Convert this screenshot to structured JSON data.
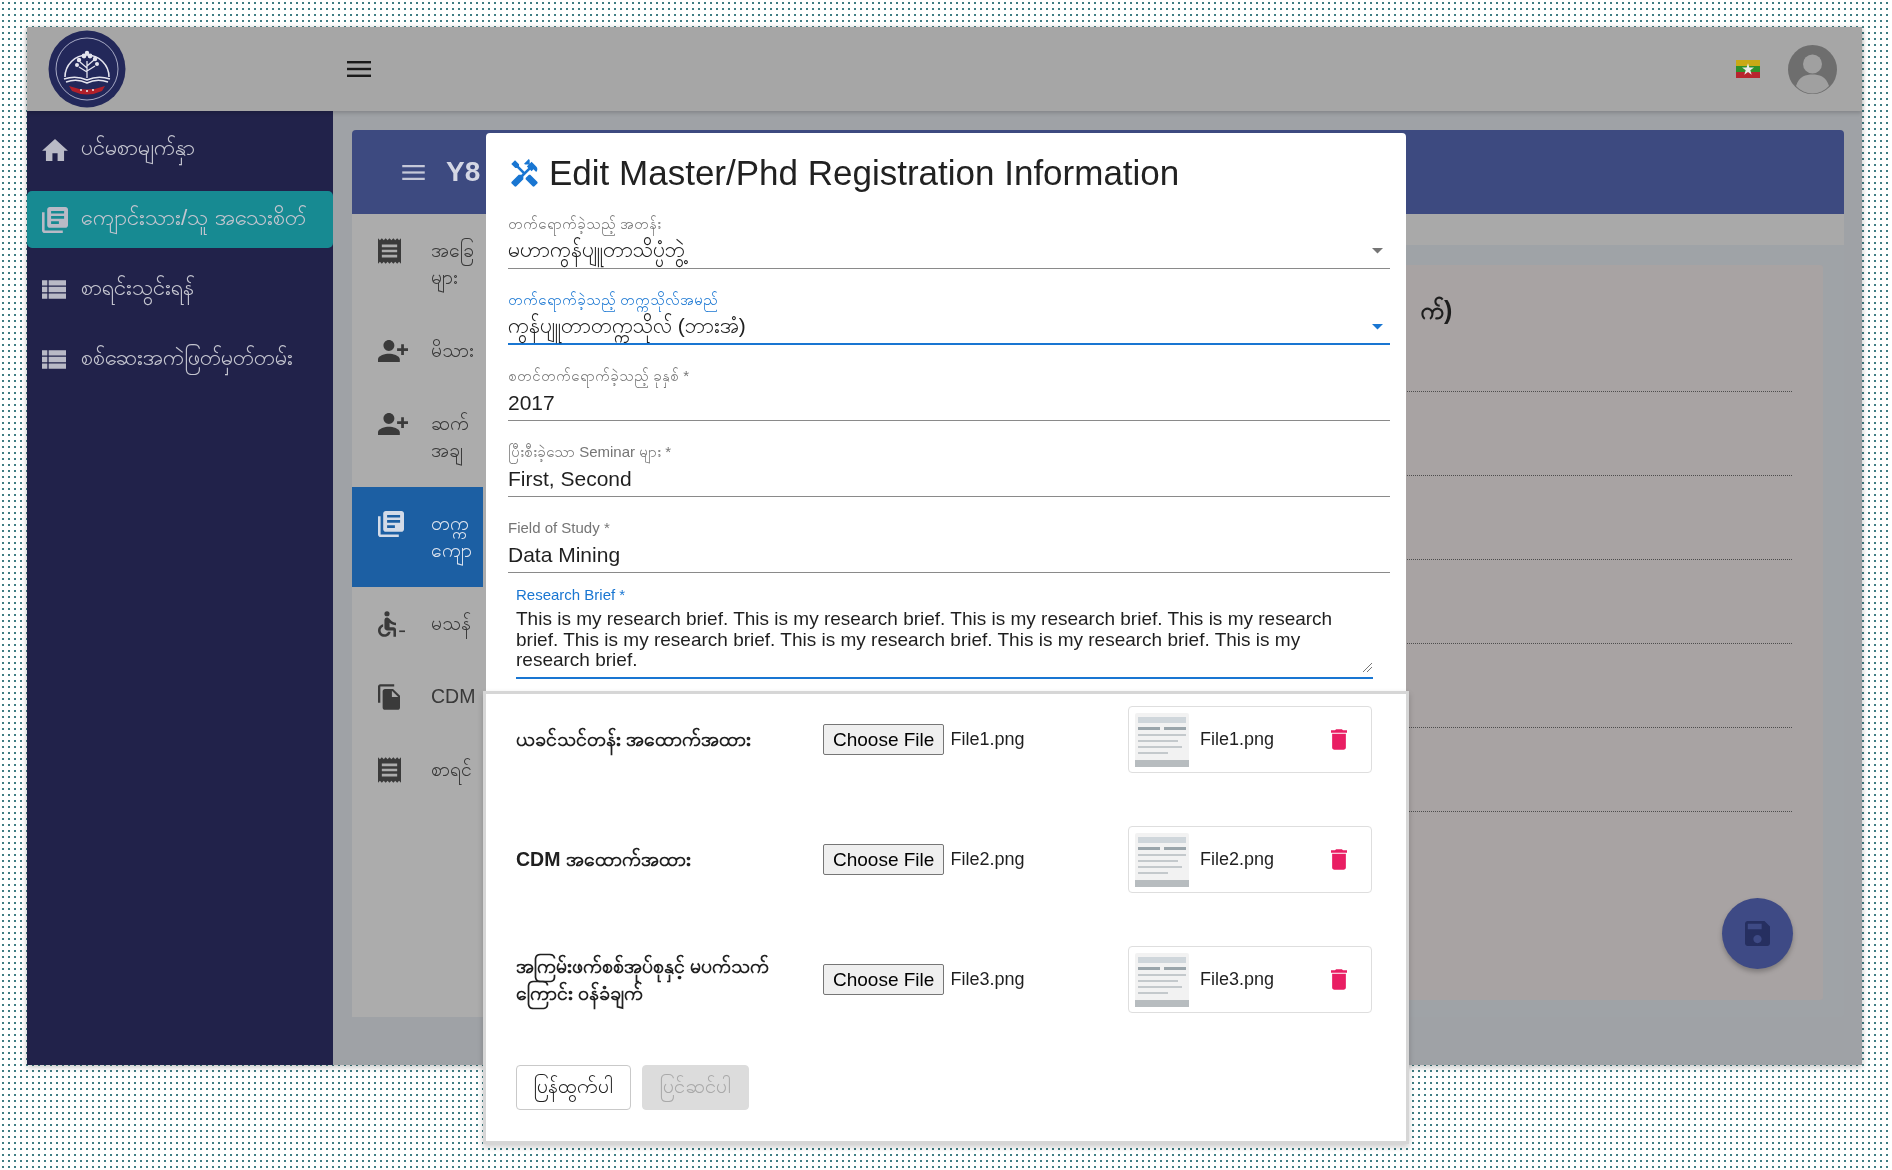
{
  "sidebar": {
    "items": [
      {
        "kind": "home",
        "label": "ပင်မစာမျက်နှာ",
        "selected": false
      },
      {
        "kind": "records",
        "label": "ကျောင်းသား/သူ အသေးစိတ်",
        "selected": true
      },
      {
        "kind": "list",
        "label": "စာရင်းသွင်းရန်",
        "selected": false
      },
      {
        "kind": "list",
        "label": "စစ်ဆေးအကဲဖြတ်မှတ်တမ်း",
        "selected": false
      }
    ]
  },
  "card": {
    "title": "Y8",
    "nav_items": [
      {
        "kind": "receipt",
        "lines": [
          "အခြေ",
          "များ"
        ],
        "selected": false
      },
      {
        "kind": "person-add",
        "lines": [
          "မိသား"
        ],
        "selected": false
      },
      {
        "kind": "person-add",
        "lines": [
          "ဆက်",
          "အချ"
        ],
        "selected": false
      },
      {
        "kind": "records",
        "lines": [
          "တက္က",
          "ကျော"
        ],
        "selected": true
      },
      {
        "kind": "accessible",
        "lines": [
          "မသန်"
        ],
        "selected": false
      },
      {
        "kind": "file",
        "lines": [
          "CDM"
        ],
        "selected": false
      },
      {
        "kind": "receipt",
        "lines": [
          "စာရင်"
        ],
        "selected": false
      }
    ],
    "panel_heading": "က်)"
  },
  "dialog": {
    "title": "Edit Master/Phd Registration Information",
    "fields": [
      {
        "kind": "select",
        "label": "တက်ရောက်ခဲ့သည့် အတန်း",
        "value": "မဟာကွန်ပျူတာသိပ္ပံဘွဲ့",
        "focused": false
      },
      {
        "kind": "select",
        "label": "တက်ရောက်ခဲ့သည့် တက္ကသိုလ်အမည်",
        "value": "ကွန်ပျူတာတက္ကသိုလ် (ဘားအံ)",
        "focused": true
      },
      {
        "kind": "text",
        "label": "စတင်တက်ရောက်ခဲ့သည့် ခုနှစ် *",
        "value": "2017",
        "focused": false
      },
      {
        "kind": "text",
        "label": "ပြီးစီးခဲ့သော Seminar များ *",
        "value": "First, Second",
        "focused": false
      },
      {
        "kind": "text",
        "label": "Field of Study *",
        "value": "Data Mining",
        "focused": false
      },
      {
        "kind": "textarea",
        "label": "Research Brief *",
        "value": "This is my research brief. This is my research brief. This is my research brief. This is my research brief. This is my research brief. This is my research brief. This is my research brief. This is my research brief.",
        "focused": true
      }
    ],
    "uploads": [
      {
        "label": "ယခင်သင်တန်း အထောက်အထား",
        "button": "Choose File",
        "chosen_file": "File1.png",
        "preview_file": "File1.png"
      },
      {
        "label": "CDM အထောက်အထား",
        "button": "Choose File",
        "chosen_file": "File2.png",
        "preview_file": "File2.png"
      },
      {
        "label": "အကြမ်းဖက်စစ်အုပ်စုနှင့် မပက်သက်ကြောင်း ဝန်ခံချက်",
        "button": "Choose File",
        "chosen_file": "File3.png",
        "preview_file": "File3.png"
      }
    ],
    "actions": [
      {
        "label": "ပြန်ထွက်ပါ",
        "disabled": false
      },
      {
        "label": "ပြင်ဆင်ပါ",
        "disabled": true
      }
    ]
  }
}
